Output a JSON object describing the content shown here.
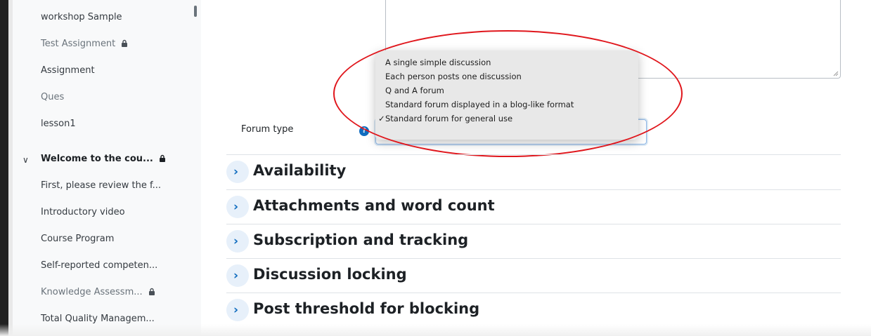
{
  "sidebar": {
    "items": [
      {
        "label": "workshop Sample",
        "locked": false,
        "muted": false
      },
      {
        "label": "Test Assignment",
        "locked": true,
        "muted": true
      },
      {
        "label": "Assignment",
        "locked": false,
        "muted": false
      },
      {
        "label": "Ques",
        "locked": false,
        "muted": true
      },
      {
        "label": "lesson1",
        "locked": false,
        "muted": false
      }
    ],
    "section": {
      "label": "Welcome to the cou...",
      "locked": true
    },
    "section_items": [
      {
        "label": "First, please review the f...",
        "locked": false
      },
      {
        "label": "Introductory video",
        "locked": false
      },
      {
        "label": "Course Program",
        "locked": false
      },
      {
        "label": "Self-reported competen...",
        "locked": false
      },
      {
        "label": "Knowledge Assessm...",
        "locked": true
      },
      {
        "label": "Total Quality Managem...",
        "locked": false
      }
    ]
  },
  "form": {
    "forum_type_label": "Forum type",
    "help_icon_glyph": "?",
    "dropdown_options": [
      {
        "label": "A single simple discussion",
        "selected": false
      },
      {
        "label": "Each person posts one discussion",
        "selected": false
      },
      {
        "label": "Q and A forum",
        "selected": false
      },
      {
        "label": "Standard forum displayed in a blog-like format",
        "selected": false
      },
      {
        "label": "Standard forum for general use",
        "selected": true
      }
    ],
    "check_glyph": "✓"
  },
  "sections": [
    {
      "title": "Availability"
    },
    {
      "title": "Attachments and word count"
    },
    {
      "title": "Subscription and tracking"
    },
    {
      "title": "Discussion locking"
    },
    {
      "title": "Post threshold for blocking"
    }
  ],
  "colors": {
    "accent": "#0f6cbf",
    "annotation_circle": "#e0161c",
    "sidebar_bg": "#f8f9fa"
  }
}
